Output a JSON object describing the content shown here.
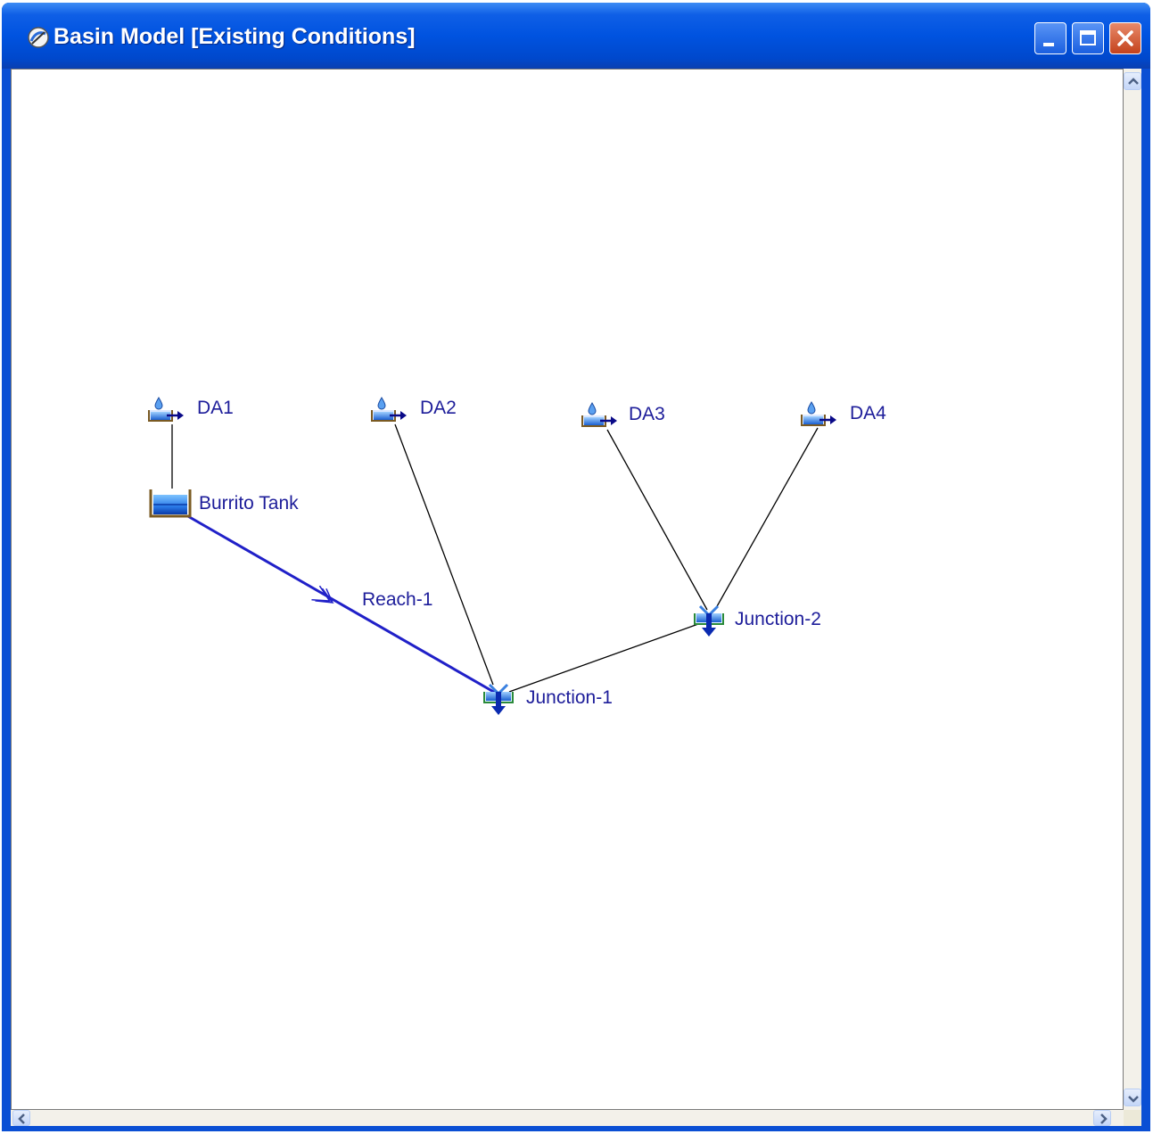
{
  "window": {
    "title": "Basin Model [Existing Conditions]",
    "title_color": "#ffffff",
    "titlebar_color": "#0053e0",
    "icon": "basin-model-app-icon",
    "controls": [
      "minimize-icon",
      "maximize-icon",
      "close-icon"
    ]
  },
  "diagram": {
    "label_color": "#1d1d9a",
    "reach_color": "#2020c8",
    "link_color": "#000000",
    "nodes": [
      {
        "id": "DA1",
        "label": "DA1",
        "type": "subbasin",
        "icon": "subbasin-icon"
      },
      {
        "id": "DA2",
        "label": "DA2",
        "type": "subbasin",
        "icon": "subbasin-icon"
      },
      {
        "id": "DA3",
        "label": "DA3",
        "type": "subbasin",
        "icon": "subbasin-icon"
      },
      {
        "id": "DA4",
        "label": "DA4",
        "type": "subbasin",
        "icon": "subbasin-icon"
      },
      {
        "id": "Burrito Tank",
        "label": "Burrito Tank",
        "type": "reservoir",
        "icon": "reservoir-icon"
      },
      {
        "id": "Junction-1",
        "label": "Junction-1",
        "type": "junction",
        "icon": "junction-icon"
      },
      {
        "id": "Junction-2",
        "label": "Junction-2",
        "type": "junction",
        "icon": "junction-icon"
      },
      {
        "id": "Reach-1",
        "label": "Reach-1",
        "type": "reach",
        "icon": "reach-icon"
      }
    ],
    "connections": [
      {
        "from": "DA1",
        "to": "Burrito Tank"
      },
      {
        "from": "Burrito Tank",
        "to": "Junction-1",
        "via": "Reach-1"
      },
      {
        "from": "DA2",
        "to": "Junction-1"
      },
      {
        "from": "DA3",
        "to": "Junction-2"
      },
      {
        "from": "DA4",
        "to": "Junction-2"
      },
      {
        "from": "Junction-2",
        "to": "Junction-1"
      }
    ]
  },
  "scrollbars": {
    "vertical": [
      "scroll-up-icon",
      "scroll-down-icon"
    ],
    "horizontal": [
      "scroll-left-icon",
      "scroll-right-icon"
    ]
  }
}
